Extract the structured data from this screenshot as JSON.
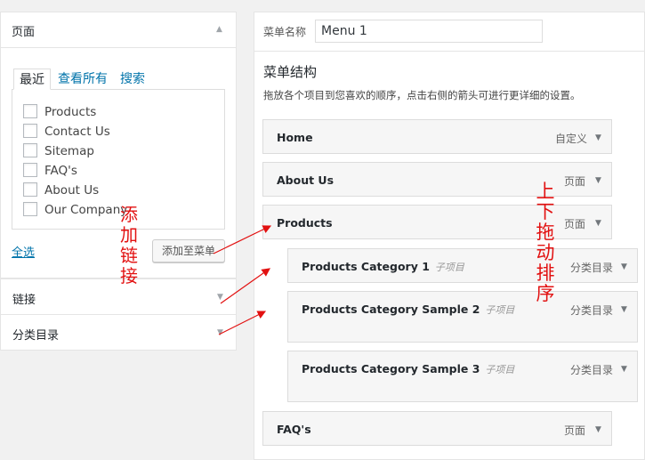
{
  "left_panel": {
    "pages_section": {
      "title": "页面",
      "tabs": [
        "最近",
        "查看所有",
        "搜索"
      ],
      "items": [
        "Products",
        "Contact Us",
        "Sitemap",
        "FAQ's",
        "About Us",
        "Our Company"
      ],
      "select_all": "全选",
      "add_button": "添加至菜单"
    },
    "links_section": {
      "title": "链接"
    },
    "categories_section": {
      "title": "分类目录"
    }
  },
  "menu": {
    "name_label": "菜单名称",
    "name_value": "Menu 1",
    "structure_title": "菜单结构",
    "structure_desc": "拖放各个项目到您喜欢的顺序，点击右侧的箭头可进行更详细的设置。",
    "sub_item_label": "子项目",
    "sub_item_label_wrap": "目",
    "items": [
      {
        "title": "Home",
        "type": "自定义"
      },
      {
        "title": "About Us",
        "type": "页面"
      },
      {
        "title": "Products",
        "type": "页面"
      },
      {
        "title": "Products Category 1",
        "type": "分类目录"
      },
      {
        "title": "Products Category Sample 2",
        "type": "分类目录"
      },
      {
        "title": "Products Category Sample 3",
        "type": "分类目录"
      },
      {
        "title": "FAQ's",
        "type": "页面"
      }
    ]
  },
  "annotations": {
    "add_link": "添加链接",
    "drag_sort": "上下拖动排序"
  }
}
